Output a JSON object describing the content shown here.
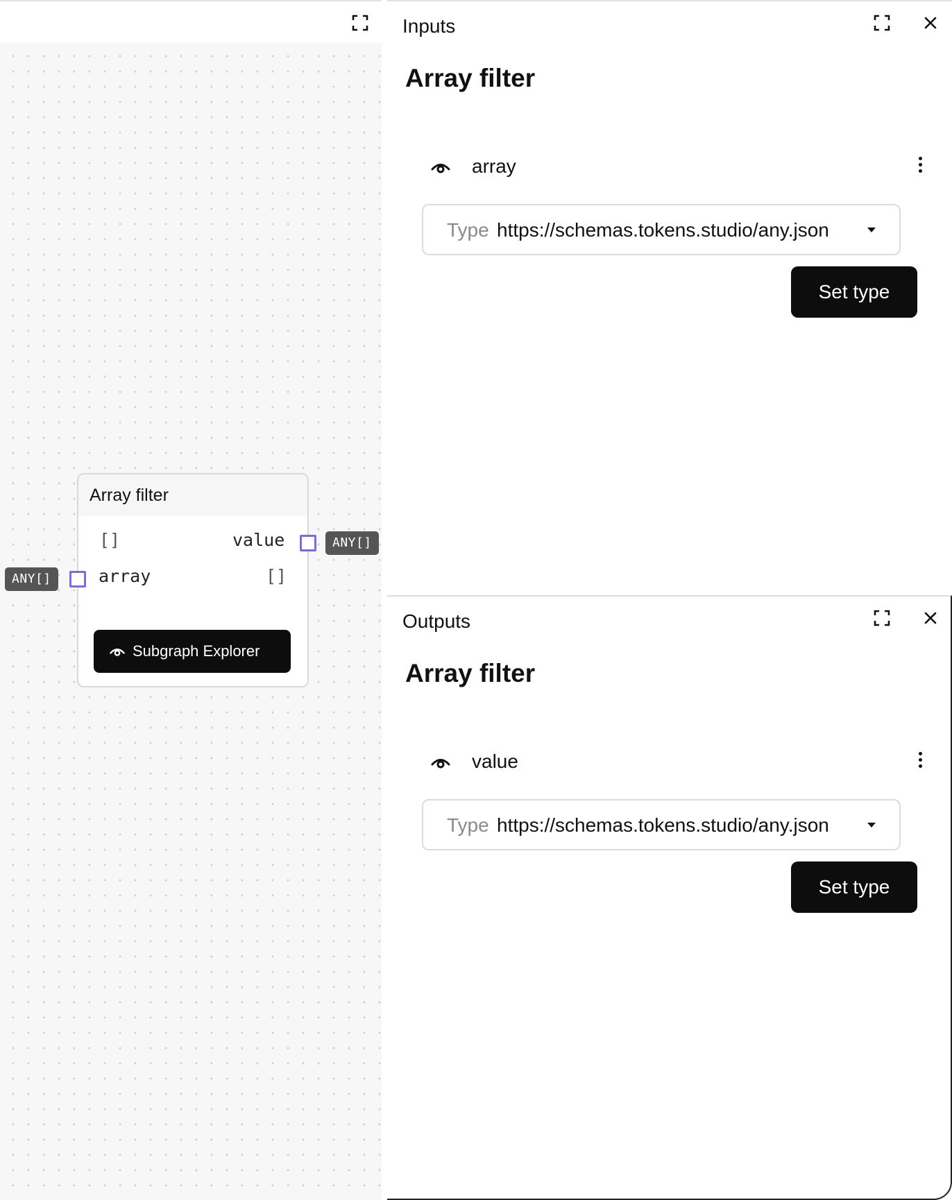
{
  "graph": {
    "node": {
      "title": "Array filter",
      "output_default": "[]",
      "output_name": "value",
      "output_type": "ANY[]",
      "input_name": "array",
      "input_default": "[]",
      "input_type": "ANY[]",
      "subgraph_button": "Subgraph Explorer"
    }
  },
  "inputs_panel": {
    "label": "Inputs",
    "heading": "Array filter",
    "port_name": "array",
    "type_label": "Type",
    "type_value": "https://schemas.tokens.studio/any.json",
    "set_type_label": "Set type"
  },
  "outputs_panel": {
    "label": "Outputs",
    "heading": "Array filter",
    "port_name": "value",
    "type_label": "Type",
    "type_value": "https://schemas.tokens.studio/any.json",
    "set_type_label": "Set type"
  },
  "colors": {
    "port_border": "#7b6cd6",
    "badge_bg": "#555555",
    "button_bg": "#0d0d0d",
    "canvas_bg": "#f7f7f7"
  },
  "icons": [
    "expand-icon",
    "close-icon",
    "eye-icon",
    "kebab-menu-icon",
    "caret-down-icon"
  ]
}
